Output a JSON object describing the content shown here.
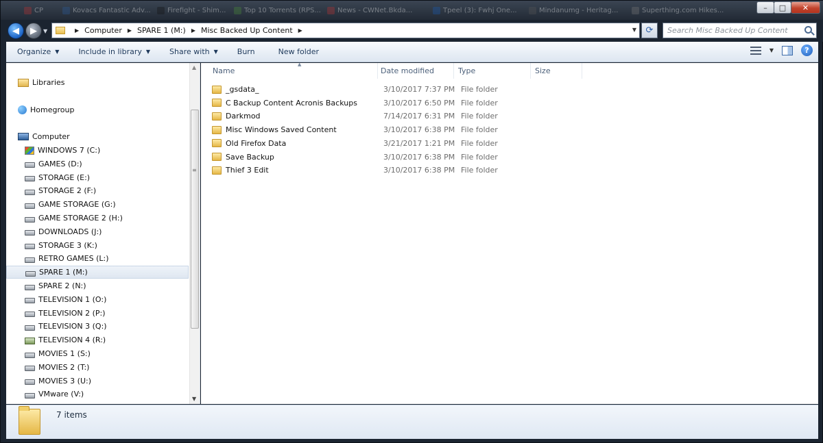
{
  "background_tabs": [
    "CP",
    "Kovacs Fantastic Adv...",
    "Firefight - Shim...",
    "Top 10 Torrents (RPS...",
    "News - CWNet.Bkda...",
    "Tpeel (3): Fwhj One...",
    "Mindanumg - Heritag...",
    "Superthing.com Hikes..."
  ],
  "window_controls": {
    "minimize": "–",
    "maximize": "□",
    "close": "✕"
  },
  "address": {
    "crumbs": [
      "Computer",
      "SPARE 1 (M:)",
      "Misc Backed Up Content"
    ]
  },
  "search": {
    "placeholder": "Search Misc Backed Up Content"
  },
  "toolbar": {
    "organize": "Organize",
    "include_in_library": "Include in library",
    "share_with": "Share with",
    "burn": "Burn",
    "new_folder": "New folder"
  },
  "sidebar": {
    "libraries": "Libraries",
    "homegroup": "Homegroup",
    "computer": "Computer",
    "drives": [
      {
        "label": "WINDOWS 7 (C:)",
        "icon": "windows-drive-icon"
      },
      {
        "label": "GAMES (D:)",
        "icon": "drive-icon"
      },
      {
        "label": "STORAGE (E:)",
        "icon": "drive-icon"
      },
      {
        "label": "STORAGE 2 (F:)",
        "icon": "drive-icon"
      },
      {
        "label": "GAME STORAGE (G:)",
        "icon": "drive-icon"
      },
      {
        "label": "GAME STORAGE 2 (H:)",
        "icon": "drive-icon"
      },
      {
        "label": "DOWNLOADS (J:)",
        "icon": "drive-icon"
      },
      {
        "label": "STORAGE 3 (K:)",
        "icon": "drive-icon"
      },
      {
        "label": "RETRO GAMES (L:)",
        "icon": "drive-icon"
      },
      {
        "label": "SPARE 1 (M:)",
        "icon": "drive-icon",
        "selected": true
      },
      {
        "label": "SPARE 2 (N:)",
        "icon": "drive-icon"
      },
      {
        "label": "TELEVISION 1 (O:)",
        "icon": "drive-icon"
      },
      {
        "label": "TELEVISION 2 (P:)",
        "icon": "drive-icon"
      },
      {
        "label": "TELEVISION 3 (Q:)",
        "icon": "drive-icon"
      },
      {
        "label": "TELEVISION 4 (R:)",
        "icon": "network-drive-icon"
      },
      {
        "label": "MOVIES 1 (S:)",
        "icon": "drive-icon"
      },
      {
        "label": "MOVIES 2 (T:)",
        "icon": "drive-icon"
      },
      {
        "label": "MOVIES 3 (U:)",
        "icon": "drive-icon"
      },
      {
        "label": "VMware (V:)",
        "icon": "drive-icon"
      }
    ]
  },
  "columns": {
    "name": "Name",
    "date": "Date modified",
    "type": "Type",
    "size": "Size"
  },
  "files": [
    {
      "name": "_gsdata_",
      "date": "3/10/2017 7:37 PM",
      "type": "File folder"
    },
    {
      "name": "C Backup Content Acronis Backups",
      "date": "3/10/2017 6:50 PM",
      "type": "File folder"
    },
    {
      "name": "Darkmod",
      "date": "7/14/2017 6:31 PM",
      "type": "File folder"
    },
    {
      "name": "Misc Windows Saved Content",
      "date": "3/10/2017 6:38 PM",
      "type": "File folder"
    },
    {
      "name": "Old Firefox Data",
      "date": "3/21/2017 1:21 PM",
      "type": "File folder"
    },
    {
      "name": "Save Backup",
      "date": "3/10/2017 6:38 PM",
      "type": "File folder"
    },
    {
      "name": "Thief 3 Edit",
      "date": "3/10/2017 6:38 PM",
      "type": "File folder"
    }
  ],
  "status": {
    "item_count": "7 items"
  }
}
